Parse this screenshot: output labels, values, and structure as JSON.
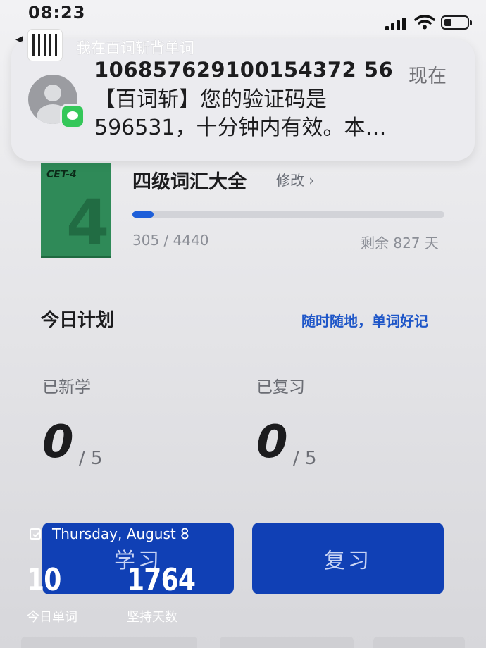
{
  "status_bar": {
    "time": "08:23"
  },
  "notification": {
    "app_name": "我在百词斩背单词",
    "sender": "106857629100154372 56",
    "time": "现在",
    "body_line1": "【百词斩】您的验证码是",
    "body_line2": "596531，十分钟内有效。本…"
  },
  "book": {
    "cover_label": "CET-4",
    "cover_number": "4",
    "title": "四级词汇大全",
    "edit_label": "修改 ›",
    "progress_text": "305 / 4440",
    "progress_fraction": 0.0687,
    "remaining": "剩余 827 天"
  },
  "plan": {
    "title": "今日计划",
    "slogan": "随时随地，单词好记",
    "new_label": "已新学",
    "new_count": "0",
    "new_target": "/ 5",
    "review_label": "已复习",
    "review_count": "0",
    "review_target": "/ 5"
  },
  "buttons": {
    "learn": "学习",
    "review": "复习"
  },
  "widget": {
    "date": "Thursday, August 8",
    "words_today": "10",
    "words_today_label": "今日单词",
    "streak_days": "1764",
    "streak_label": "坚持天数"
  },
  "colors": {
    "accent": "#1040b5",
    "progress": "#1e5fd9",
    "slogan": "#1e56c8",
    "book_cover": "#2f8a58"
  }
}
